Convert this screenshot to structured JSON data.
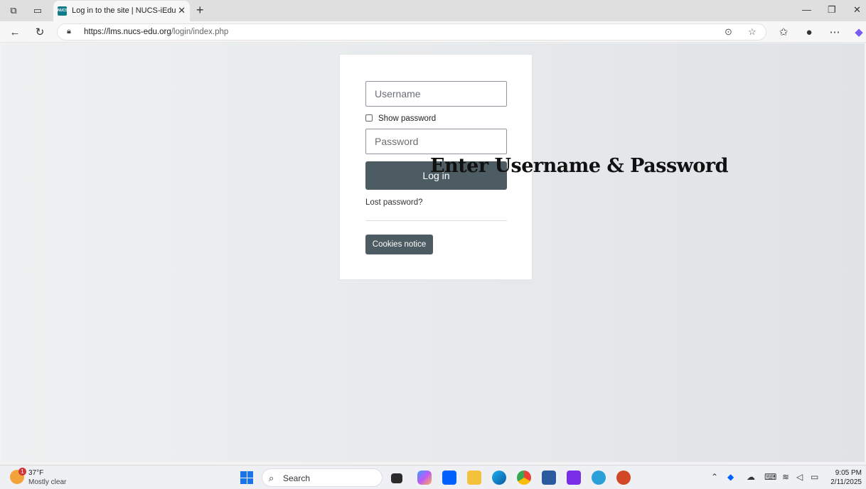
{
  "browser": {
    "tab_title": "Log in to the site | NUCS-iEdu",
    "tab_favicon_text": "NUCS",
    "url_host": "https://lms.nucs-edu.org",
    "url_path": "/login/index.php"
  },
  "login": {
    "username_placeholder": "Username",
    "show_password_label": "Show password",
    "password_placeholder": "Password",
    "login_button": "Log in",
    "lost_password": "Lost password?",
    "cookies_button": "Cookies notice"
  },
  "overlay_text": "Enter Username & Password",
  "taskbar": {
    "weather_temp": "37°F",
    "weather_desc": "Mostly clear",
    "weather_badge": "1",
    "search_label": "Search",
    "time": "9:05 PM",
    "date": "2/11/2025"
  },
  "colors": {
    "button": "#4d5b63",
    "favicon": "#117a8b"
  }
}
